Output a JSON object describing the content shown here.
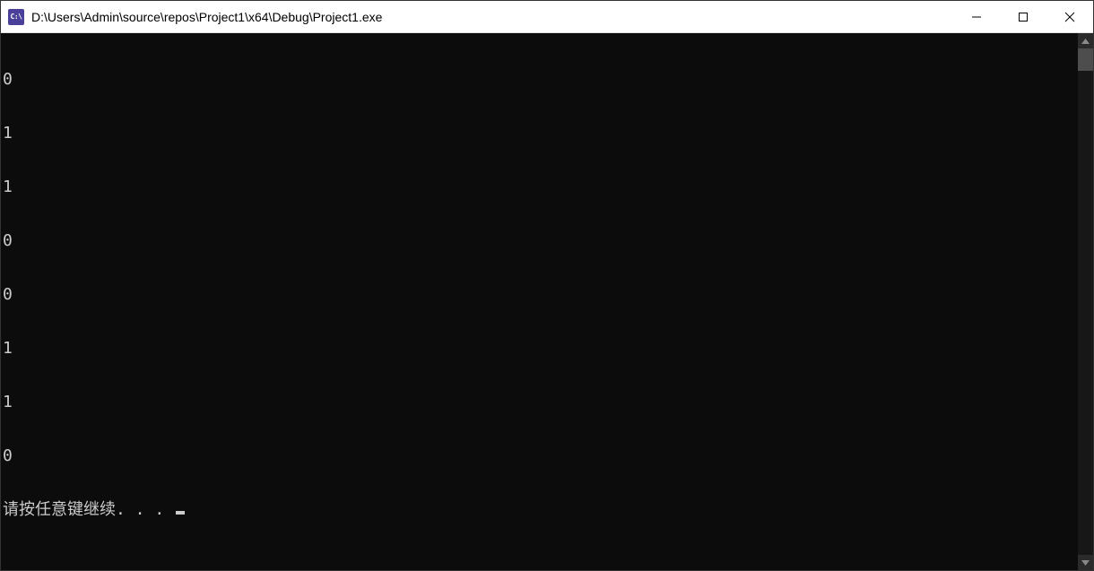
{
  "window": {
    "icon_label": "C:\\",
    "title": "D:\\Users\\Admin\\source\\repos\\Project1\\x64\\Debug\\Project1.exe"
  },
  "console": {
    "lines": [
      "0",
      "1",
      "1",
      "0",
      "0",
      "1",
      "1",
      "0"
    ],
    "prompt": "请按任意键继续. . . "
  }
}
